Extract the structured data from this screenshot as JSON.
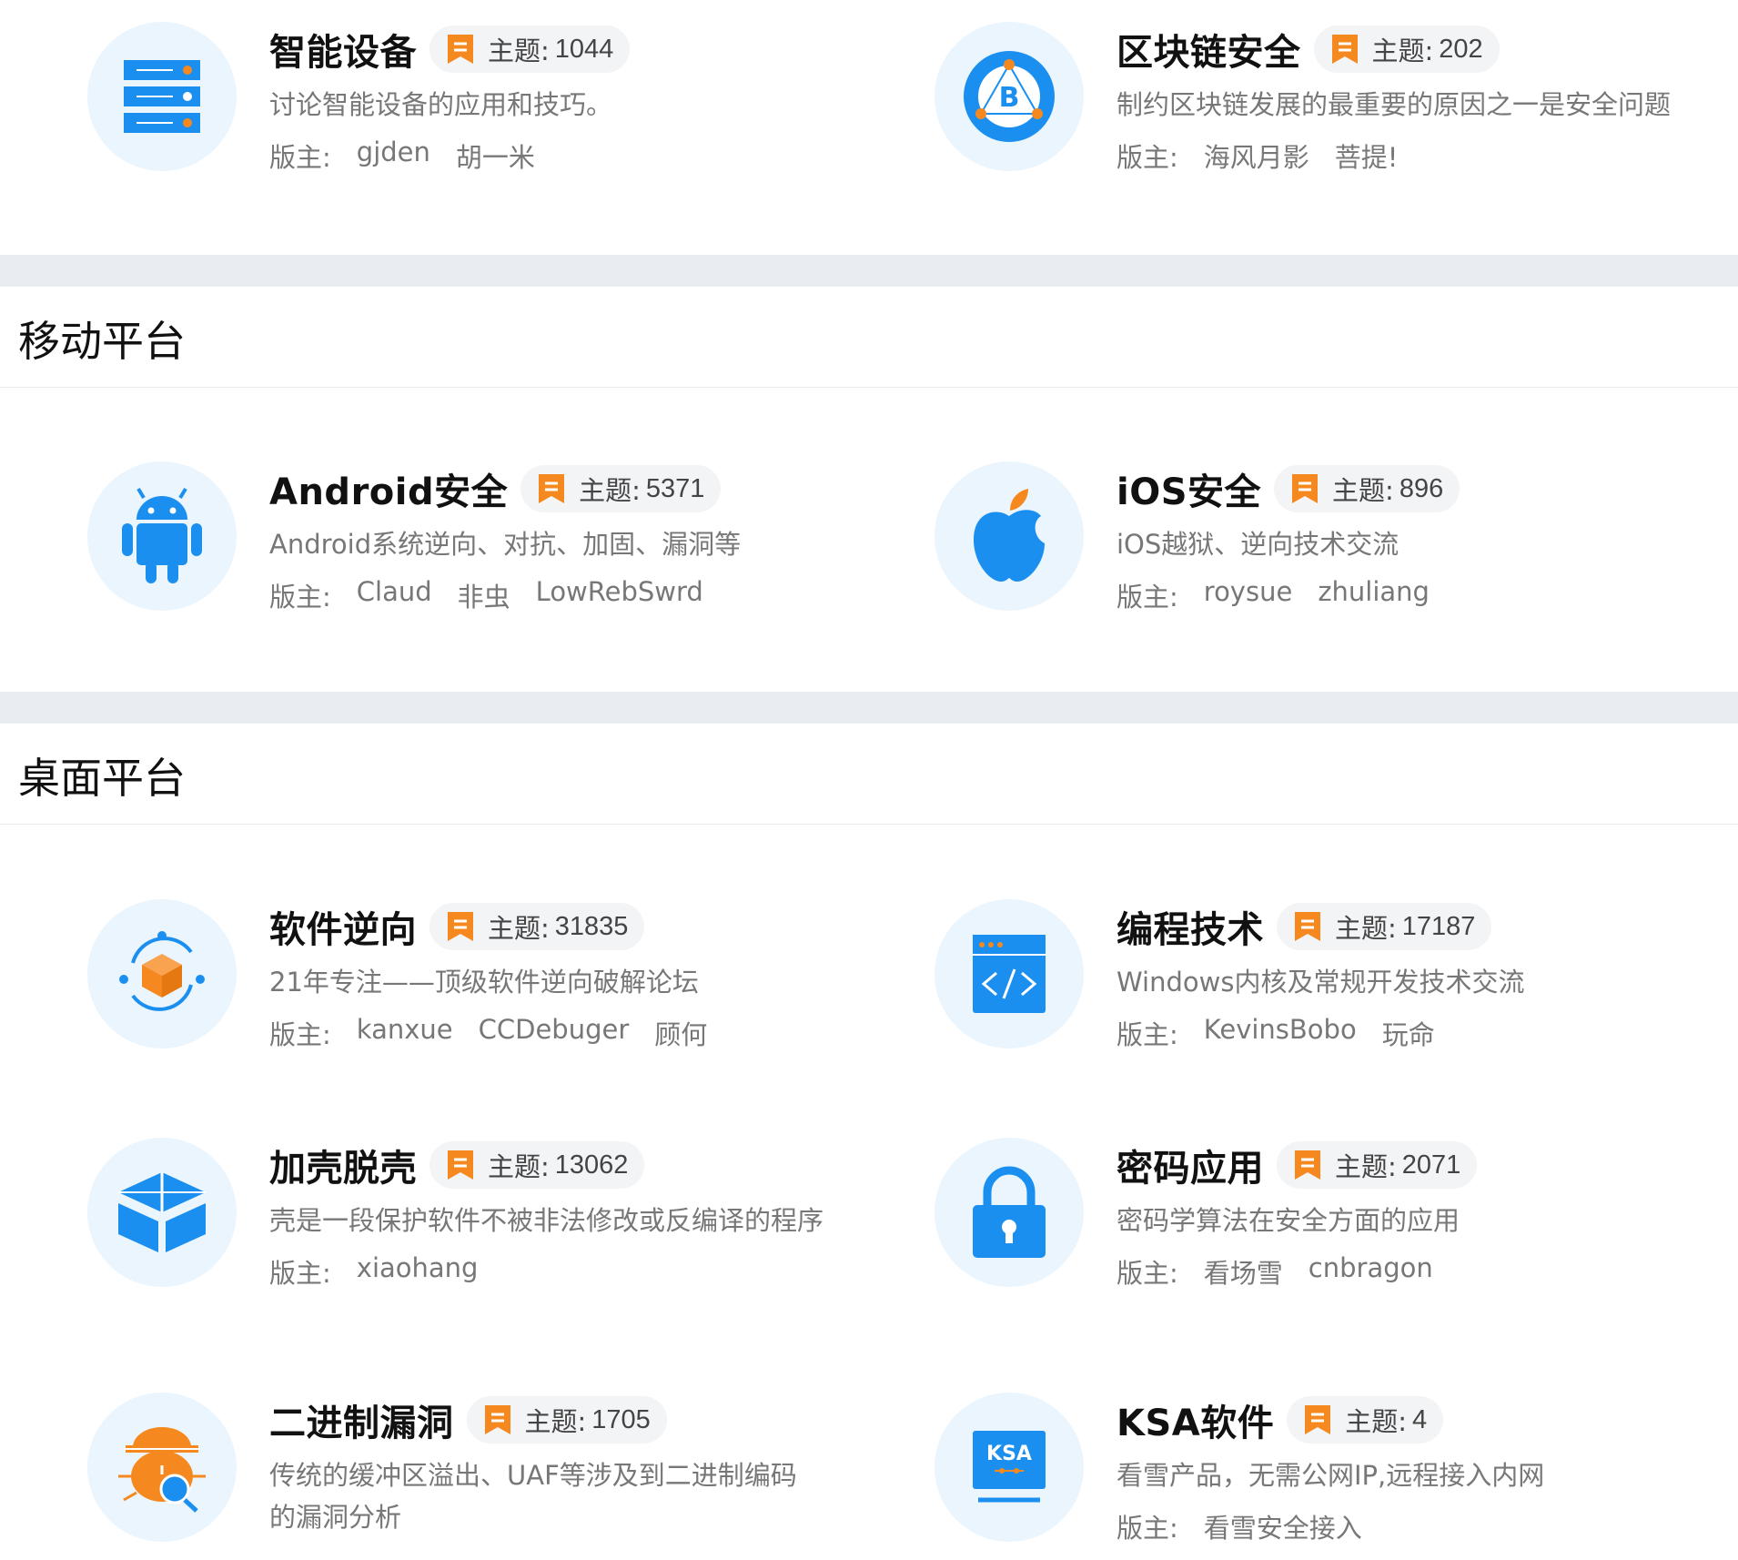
{
  "colors": {
    "accent": "#1a8ff0",
    "badge_orange": "#f5891f",
    "band": "#e9edf1"
  },
  "topic_label": "主题:",
  "mod_label": "版主:",
  "sections": [
    {
      "title": "",
      "forums": [
        {
          "name": "智能设备",
          "topics": "1044",
          "desc": "讨论智能设备的应用和技巧。",
          "mods": [
            "gjden",
            "胡一米"
          ],
          "icon": "server-icon"
        },
        {
          "name": "区块链安全",
          "topics": "202",
          "desc": "制约区块链发展的最重要的原因之一是安全问题",
          "mods": [
            "海风月影",
            "菩提!"
          ],
          "icon": "blockchain-icon"
        }
      ]
    },
    {
      "title": "移动平台",
      "forums": [
        {
          "name": "Android安全",
          "topics": "5371",
          "desc": "Android系统逆向、对抗、加固、漏洞等",
          "mods": [
            "Claud",
            "非虫",
            "LowRebSwrd"
          ],
          "icon": "android-icon"
        },
        {
          "name": "iOS安全",
          "topics": "896",
          "desc": "iOS越狱、逆向技术交流",
          "mods": [
            "roysue",
            "zhuliang"
          ],
          "icon": "apple-icon"
        }
      ]
    },
    {
      "title": "桌面平台",
      "forums": [
        {
          "name": "软件逆向",
          "topics": "31835",
          "desc": "21年专注——顶级软件逆向破解论坛",
          "mods": [
            "kanxue",
            "CCDebuger",
            "顾何"
          ],
          "icon": "cube-cycle-icon"
        },
        {
          "name": "编程技术",
          "topics": "17187",
          "desc": "Windows内核及常规开发技术交流",
          "mods": [
            "KevinsBobo",
            "玩命"
          ],
          "icon": "code-window-icon"
        },
        {
          "name": "加壳脱壳",
          "topics": "13062",
          "desc": "壳是一段保护软件不被非法修改或反编译的程序",
          "mods": [
            "xiaohang"
          ],
          "icon": "box-icon"
        },
        {
          "name": "密码应用",
          "topics": "2071",
          "desc": "密码学算法在安全方面的应用",
          "mods": [
            "看场雪",
            "cnbragon"
          ],
          "icon": "lock-icon"
        },
        {
          "name": "二进制漏洞",
          "topics": "1705",
          "desc": "传统的缓冲区溢出、UAF等涉及到二进制编码的漏洞分析",
          "mods": [],
          "icon": "bug-icon"
        },
        {
          "name": "KSA软件",
          "topics": "4",
          "desc": "看雪产品，无需公网IP,远程接入内网",
          "mods": [
            "看雪安全接入"
          ],
          "icon": "ksa-icon"
        }
      ]
    }
  ]
}
